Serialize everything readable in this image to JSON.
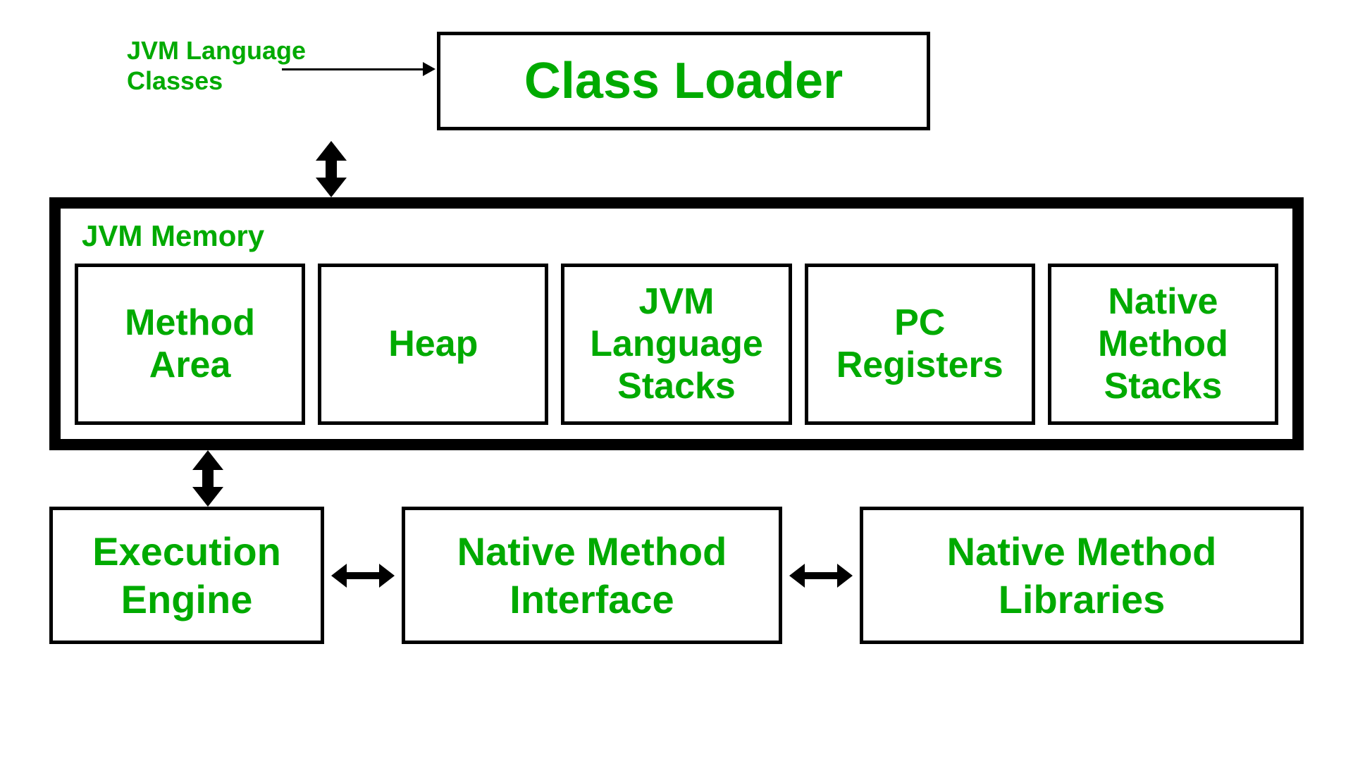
{
  "diagram": {
    "jvm_language_classes_label": "JVM Language\nClasses",
    "class_loader_label": "Class Loader",
    "jvm_memory_title": "JVM Memory",
    "memory_boxes": [
      {
        "id": "method-area",
        "label": "Method\nArea"
      },
      {
        "id": "heap",
        "label": "Heap"
      },
      {
        "id": "jvm-language-stacks",
        "label": "JVM Language\nStacks"
      },
      {
        "id": "pc-registers",
        "label": "PC\nRegisters"
      },
      {
        "id": "native-method-stacks",
        "label": "Native\nMethod\nStacks"
      }
    ],
    "bottom_boxes": [
      {
        "id": "execution-engine",
        "label": "Execution\nEngine"
      },
      {
        "id": "native-method-interface",
        "label": "Native Method\nInterface"
      },
      {
        "id": "native-method-libraries",
        "label": "Native Method\nLibraries"
      }
    ],
    "colors": {
      "green": "#00cc00",
      "black": "#000000",
      "white": "#ffffff"
    }
  }
}
